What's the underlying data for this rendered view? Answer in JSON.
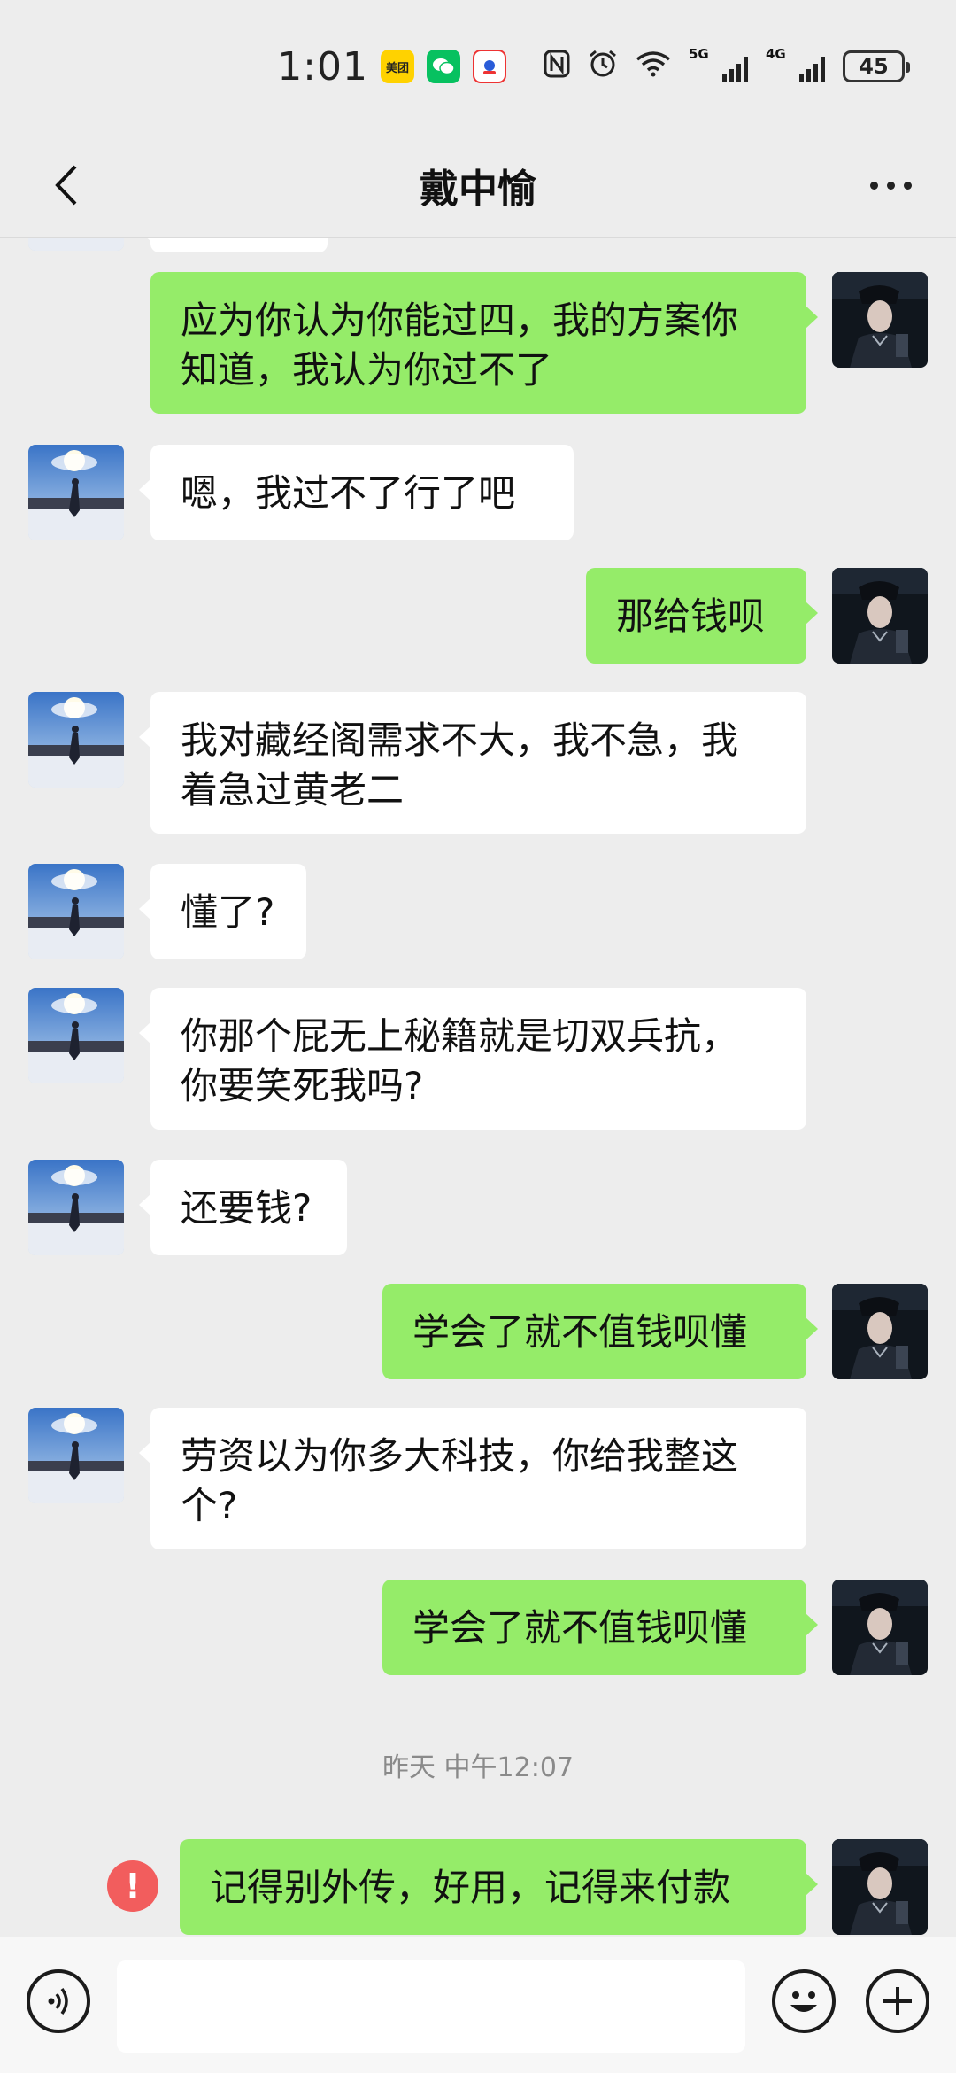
{
  "status_bar": {
    "time": "1:01",
    "apps": [
      "美团",
      "WeChat",
      "百度"
    ],
    "network_1": "5G",
    "network_2": "4G",
    "battery": "45"
  },
  "nav": {
    "title": "戴中愉",
    "back_icon": "chevron-left-icon",
    "more_icon": "more-dots-icon"
  },
  "messages": [
    {
      "side": "out",
      "text": "应为你认为你能过四，我的方案你\n知道，我认为你过不了"
    },
    {
      "side": "in",
      "text": "嗯，我过不了行了吧"
    },
    {
      "side": "out",
      "text": "那给钱呗"
    },
    {
      "side": "in",
      "text": "我对藏经阁需求不大，我不急，我\n着急过黄老二"
    },
    {
      "side": "in",
      "text": "懂了?"
    },
    {
      "side": "in",
      "text": "你那个屁无上秘籍就是切双兵抗，\n你要笑死我吗?"
    },
    {
      "side": "in",
      "text": "还要钱?"
    },
    {
      "side": "out",
      "text": "学会了就不值钱呗懂"
    },
    {
      "side": "in",
      "text": "劳资以为你多大科技，你给我整这\n个?"
    },
    {
      "side": "out",
      "text": "学会了就不值钱呗懂"
    },
    {
      "side": "out",
      "text": "记得别外传，好用，记得来付款",
      "failed": true
    }
  ],
  "timestamp": "昨天 中午12:07",
  "input_bar": {
    "voice_icon": "voice-icon",
    "input_value": "",
    "emoji_icon": "emoji-icon",
    "plus_icon": "plus-icon"
  },
  "colors": {
    "outgoing_bubble": "#95ec69",
    "incoming_bubble": "#ffffff",
    "background": "#ededed",
    "error": "#f25d5d"
  }
}
